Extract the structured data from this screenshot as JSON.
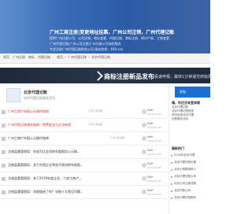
{
  "header": {
    "title": "广州工商注册|变更地址挂靠，广州公司注销，广州代理记账",
    "lines": [
      "提供广州注册公司、公司注销、地址变更、代理记账、商标注册、知识产权、工商变更、",
      "广州代理记账|广州公司注册|广州注册公司流程服务",
      "专业注册广州代理记账财务公司 服务热线：400-xxx"
    ]
  },
  "nav": {
    "items": [
      "首页",
      "广州注册",
      "商标",
      "代理记账",
      "首页",
      "›",
      "广州代理记账",
      "›",
      "北京代理记账"
    ]
  },
  "banner": {
    "title": "商标注册新品发布",
    "subtitle": "极速申报，最快1分钟递交商标局"
  },
  "forum": {
    "title": "北京代理记账",
    "description": "北京代理记账相关资讯"
  },
  "threads": [
    {
      "title": "广州工商户年报公示操作指南",
      "tag": "广州工商注册",
      "author": "fsdfr",
      "meta": "2019-10-08",
      "highlight": true
    },
    {
      "title": "广州代理记账服务指南：免费变化与企业新规",
      "tag": "广州工商注册",
      "author": "fsdfr",
      "meta": "2019-10-08",
      "highlight": true
    },
    {
      "title": "广州工商户年报公示操作指南",
      "tag": "广州工商注册",
      "author": "fsdfr",
      "meta": "2019-10-08",
      "highlight": false
    },
    {
      "title": "注册监督管理局：年轻员比支机构年度报告公示操...",
      "tag": "广州工商注册",
      "author": "fsdfr",
      "meta": "2019-10-08",
      "highlight": false
    },
    {
      "title": "注册监督管理局：关于外国企业常驻代表机构年度报...",
      "tag": "广州工商注册",
      "author": "fsdfr",
      "meta": "2019-10-08",
      "highlight": false
    },
    {
      "title": "注册监督管理局：关于2019年度企业、个体工商户...",
      "tag": "广州工商注册",
      "author": "fsdfr",
      "meta": "2019-10-08",
      "highlight": false
    },
    {
      "title": "注册监督管理局：年报链接了吗？年报十大常见问题...",
      "tag": "广州工商注册",
      "author": "fsdfr",
      "meta": "2019-10-08",
      "highlight": false
    }
  ],
  "sidebar": {
    "head_label": "发帖",
    "welcome": "嗨，你还没有登录哦",
    "texts": [
      "北京代理记账",
      "北京代理记账相关",
      "资讯信息北京代理",
      "记账服务北京"
    ],
    "section_title": "最新热门",
    "links": [
      "2020年北京代理",
      "北京代理记账价格",
      "北京小规模纳税人",
      "北京代理记账公司",
      "北京公司注销流程",
      "北京代账公司",
      "北京代理记账服务"
    ]
  },
  "colors": {
    "header_bg": "#2f62ad",
    "banner_bg": "#1e2a3c",
    "accent": "#1b6ed4",
    "highlight_text": "#d9342b",
    "link_text": "#333333"
  }
}
